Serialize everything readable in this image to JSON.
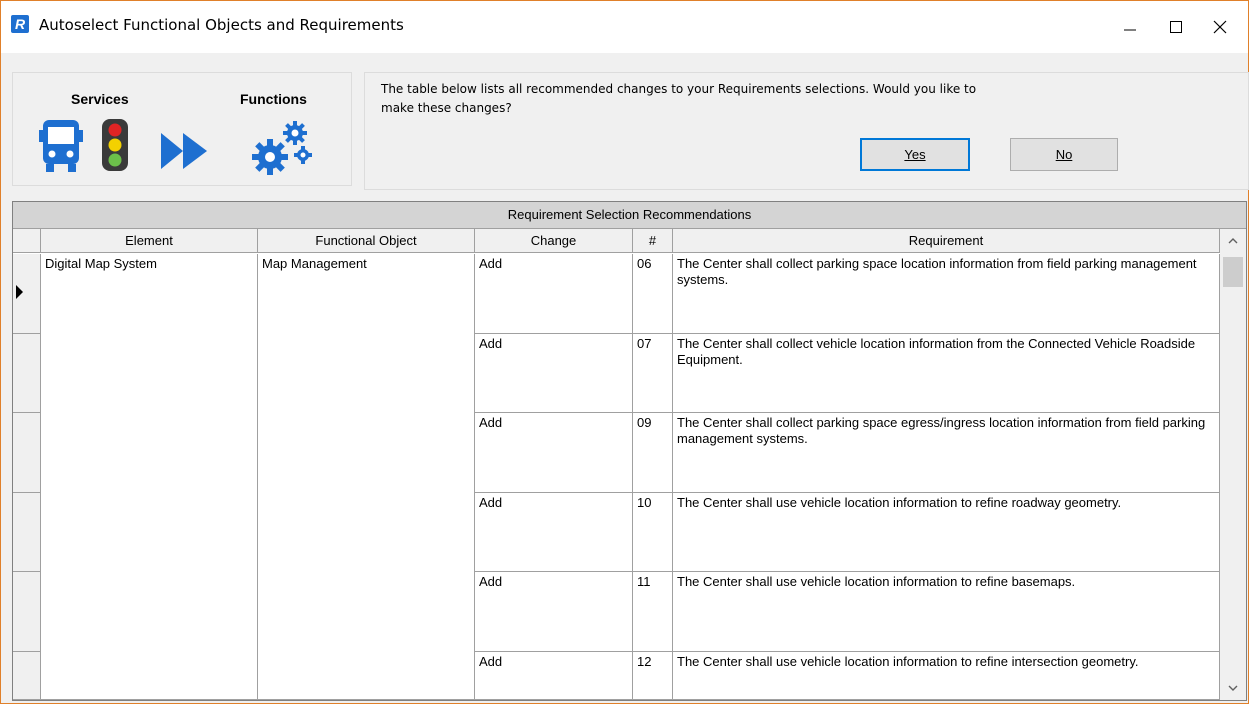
{
  "window": {
    "title": "Autoselect Functional Objects and Requirements",
    "app_icon_letter": "R"
  },
  "banner": {
    "services_label": "Services",
    "functions_label": "Functions"
  },
  "prompt": {
    "text_line1": "The table below lists all recommended changes to your Requirements selections.  Would you like to",
    "text_line2": "make these changes?",
    "yes_label": "Yes",
    "no_label": "No"
  },
  "table": {
    "caption": "Requirement Selection Recommendations",
    "columns": [
      "Element",
      "Functional Object",
      "Change",
      "#",
      "Requirement"
    ],
    "element": "Digital Map System",
    "functional_object": "Map Management",
    "rows": [
      {
        "change": "Add",
        "num": "06",
        "requirement": "The Center shall collect parking space location information from field parking management systems."
      },
      {
        "change": "Add",
        "num": "07",
        "requirement": "The Center shall collect vehicle location information from the Connected Vehicle Roadside Equipment."
      },
      {
        "change": "Add",
        "num": "09",
        "requirement": "The Center shall collect parking space egress/ingress location information from field parking management systems."
      },
      {
        "change": "Add",
        "num": "10",
        "requirement": "The Center shall use vehicle location information to refine roadway geometry."
      },
      {
        "change": "Add",
        "num": "11",
        "requirement": "The Center shall use vehicle location information to refine basemaps."
      },
      {
        "change": "Add",
        "num": "12",
        "requirement": "The Center shall use vehicle location information to refine intersection geometry."
      }
    ]
  },
  "colors": {
    "accent": "#1e6fd0",
    "window_border": "#e0802a",
    "default_button_border": "#0078d7"
  }
}
